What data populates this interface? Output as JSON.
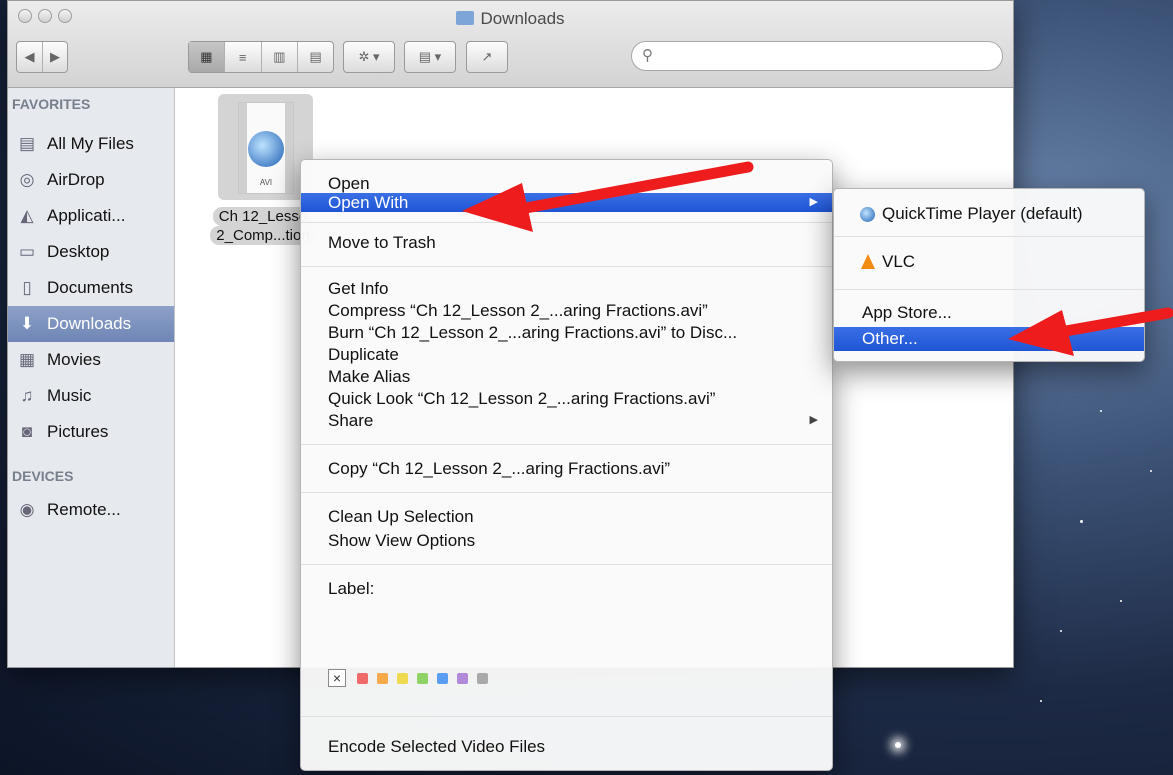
{
  "window": {
    "title": "Downloads"
  },
  "toolbar": {
    "back": "◀",
    "forward": "▶",
    "views": [
      "▦",
      "≡",
      "▥",
      "▤"
    ],
    "action": "✲ ▾",
    "arrange": "▤ ▾",
    "share": "↗",
    "search_placeholder": ""
  },
  "sidebar": {
    "favorites_header": "FAVORITES",
    "items": [
      {
        "label": "All My Files",
        "icon": "all-files-icon",
        "glyph": "▤"
      },
      {
        "label": "AirDrop",
        "icon": "airdrop-icon",
        "glyph": "◎"
      },
      {
        "label": "Applicati...",
        "icon": "applications-icon",
        "glyph": "◭"
      },
      {
        "label": "Desktop",
        "icon": "desktop-icon",
        "glyph": "▭"
      },
      {
        "label": "Documents",
        "icon": "documents-icon",
        "glyph": "▯"
      },
      {
        "label": "Downloads",
        "icon": "downloads-icon",
        "glyph": "⬇",
        "selected": true
      },
      {
        "label": "Movies",
        "icon": "movies-icon",
        "glyph": "▦"
      },
      {
        "label": "Music",
        "icon": "music-icon",
        "glyph": "♫"
      },
      {
        "label": "Pictures",
        "icon": "pictures-icon",
        "glyph": "◙"
      }
    ],
    "devices_header": "DEVICES",
    "devices": [
      {
        "label": "Remote...",
        "icon": "remote-disc-icon",
        "glyph": "◉"
      }
    ]
  },
  "file": {
    "type_badge": "AVI",
    "name_line1": "Ch 12_Lesso",
    "name_line2": "2_Comp...tion"
  },
  "context_menu": {
    "open": "Open",
    "open_with": "Open With",
    "move_to_trash": "Move to Trash",
    "get_info": "Get Info",
    "compress": "Compress “Ch 12_Lesson 2_...aring Fractions.avi”",
    "burn": "Burn “Ch 12_Lesson 2_...aring Fractions.avi” to Disc...",
    "duplicate": "Duplicate",
    "make_alias": "Make Alias",
    "quick_look": "Quick Look “Ch 12_Lesson 2_...aring Fractions.avi”",
    "share": "Share",
    "copy": "Copy “Ch 12_Lesson 2_...aring Fractions.avi”",
    "clean_up": "Clean Up Selection",
    "show_view_options": "Show View Options",
    "label_title": "Label:",
    "label_clear": "×",
    "label_colors": [
      "#f06a6a",
      "#f5a94a",
      "#efd94e",
      "#8fd266",
      "#5b9df0",
      "#b08ad8",
      "#a9a9a9"
    ],
    "encode": "Encode Selected Video Files",
    "submenu_arrow": "▶"
  },
  "open_with_submenu": {
    "quicktime": "QuickTime Player (default)",
    "vlc": "VLC",
    "app_store": "App Store...",
    "other": "Other..."
  },
  "colors": {
    "highlight": "#2a62de",
    "annotation_arrow": "#ee1c1c"
  }
}
